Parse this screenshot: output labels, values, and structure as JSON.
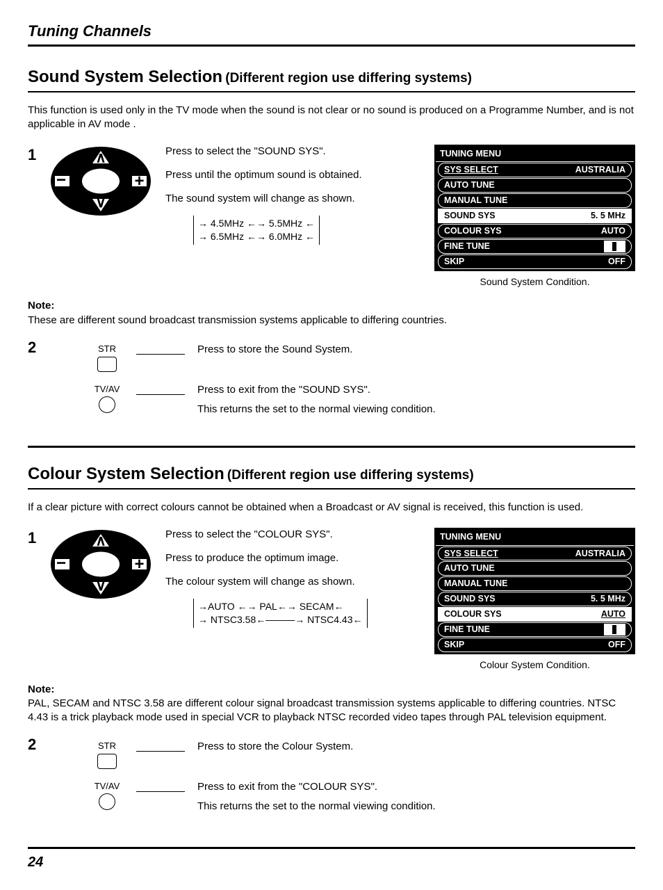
{
  "page_title": "Tuning Channels",
  "page_number": "24",
  "sound": {
    "title_main": "Sound System Selection",
    "title_sub": "(Different region use differing systems)",
    "intro": "This function is used only in the TV mode when the sound is not clear or no sound is produced on a Programme Number, and is not applicable in AV mode .",
    "step1": {
      "num": "1",
      "line1": "Press to select the \"SOUND SYS\".",
      "line2": "Press until the optimum sound is obtained.",
      "line3": "The sound system will change as shown.",
      "cycle_top": "→ 4.5MHz ←→ 5.5MHz ←",
      "cycle_bot": "→ 6.5MHz ←→ 6.0MHz ←"
    },
    "osd": {
      "title": "TUNING MENU",
      "rows": [
        {
          "label": "SYS SELECT",
          "value": "AUSTRALIA",
          "sel": false,
          "under": true
        },
        {
          "label": "AUTO TUNE",
          "value": "",
          "sel": false
        },
        {
          "label": "MANUAL TUNE",
          "value": "",
          "sel": false
        },
        {
          "label": "SOUND SYS",
          "value": "5. 5 MHz",
          "sel": true
        },
        {
          "label": "COLOUR SYS",
          "value": "AUTO",
          "sel": false
        },
        {
          "label": "FINE TUNE",
          "value": "",
          "sel": false,
          "box": true
        },
        {
          "label": "SKIP",
          "value": "OFF",
          "sel": false
        }
      ],
      "caption": "Sound System Condition."
    },
    "note_label": "Note:",
    "note_text": "These are different sound broadcast transmission systems applicable to differing countries.",
    "step2": {
      "num": "2",
      "str_label": "STR",
      "str_text": "Press to store the Sound System.",
      "tvav_label": "TV/AV",
      "tvav_text1": "Press to exit from the \"SOUND SYS\".",
      "tvav_text2": "This returns the set to the normal viewing condition."
    }
  },
  "colour": {
    "title_main": "Colour System Selection",
    "title_sub": "(Different region use differing systems)",
    "intro": "If a clear picture with correct colours cannot be obtained when a Broadcast or AV signal is received, this function is used.",
    "step1": {
      "num": "1",
      "line1": "Press to select the \"COLOUR SYS\".",
      "line2": "Press to produce the optimum image.",
      "line3": "The colour system will change as shown.",
      "cycle_top": "→AUTO ←→ PAL←→ SECAM←",
      "cycle_bot": "→ NTSC3.58←———→ NTSC4.43←"
    },
    "osd": {
      "title": "TUNING MENU",
      "rows": [
        {
          "label": "SYS SELECT",
          "value": "AUSTRALIA",
          "sel": false,
          "under": true
        },
        {
          "label": "AUTO TUNE",
          "value": "",
          "sel": false
        },
        {
          "label": "MANUAL TUNE",
          "value": "",
          "sel": false
        },
        {
          "label": "SOUND SYS",
          "value": "5. 5 MHz",
          "sel": false
        },
        {
          "label": "COLOUR SYS",
          "value": "AUTO",
          "sel": true,
          "valunder": true
        },
        {
          "label": "FINE TUNE",
          "value": "",
          "sel": false,
          "box": true
        },
        {
          "label": "SKIP",
          "value": "OFF",
          "sel": false
        }
      ],
      "caption": "Colour  System Condition."
    },
    "note_label": "Note:",
    "note_text": "PAL, SECAM and NTSC 3.58 are different colour signal broadcast transmission systems applicable to differing countries. NTSC 4.43 is a trick playback mode used in special VCR to playback NTSC recorded video tapes through PAL television equipment.",
    "step2": {
      "num": "2",
      "str_label": "STR",
      "str_text": "Press to store the Colour System.",
      "tvav_label": "TV/AV",
      "tvav_text1": "Press to exit from the \"COLOUR SYS\".",
      "tvav_text2": "This returns the set to the normal viewing condition."
    }
  }
}
